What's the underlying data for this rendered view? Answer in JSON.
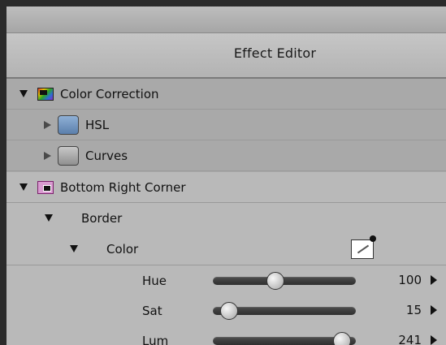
{
  "window": {
    "title": "Effect Editor"
  },
  "tree": {
    "color_correction": {
      "label": "Color Correction"
    },
    "hsl": {
      "label": "HSL"
    },
    "curves": {
      "label": "Curves"
    },
    "bottom_right_corner": {
      "label": "Bottom Right Corner"
    },
    "border": {
      "label": "Border"
    },
    "color": {
      "label": "Color"
    }
  },
  "sliders": [
    {
      "name": "Hue",
      "value": "100",
      "level": 0.42
    },
    {
      "name": "Sat",
      "value": "15",
      "level": 0.06
    },
    {
      "name": "Lum",
      "value": "241",
      "level": 0.95
    }
  ],
  "icons": {
    "expand_down": "triangle-down-icon",
    "expand_right": "triangle-right-icon",
    "color_correction": "color-correction-icon",
    "pip": "picture-in-picture-icon",
    "color_picker": "eyedropper-icon",
    "increment": "triangle-right-arrow-icon"
  },
  "colors": {
    "hsl_swatch": "#7b9cc6",
    "curves_swatch": "#b0b0b0"
  }
}
